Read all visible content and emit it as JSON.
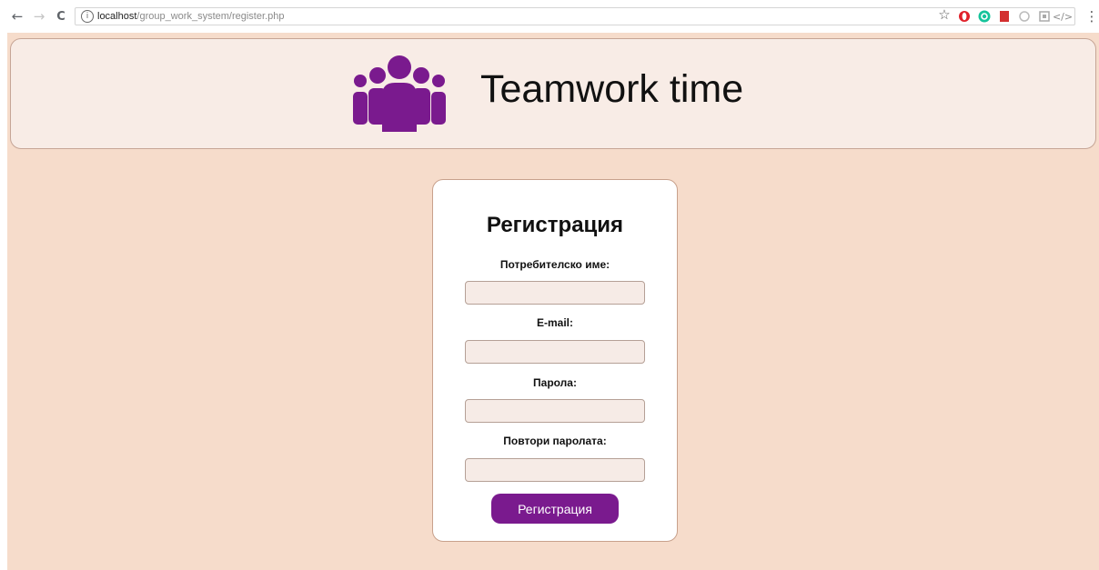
{
  "browser": {
    "back_glyph": "←",
    "forward_glyph": "→",
    "reload_glyph": "C",
    "url_host": "localhost",
    "url_path": "/group_work_system/register.php",
    "extensions": [
      "star-icon",
      "opera-icon",
      "grammarly-icon",
      "bookmark-red-icon",
      "extension-circle-icon",
      "extension-square-icon",
      "code-icon",
      "extension-box-icon",
      "menu-icon"
    ],
    "star_glyph": "☆",
    "menu_glyph": "⋮"
  },
  "header": {
    "title": "Teamwork time",
    "logo_icon": "team-people-icon",
    "logo_color": "#7a1a8e"
  },
  "form": {
    "title": "Регистрация",
    "username_label": "Потребителско име:",
    "email_label": "E-mail:",
    "password_label": "Парола:",
    "repeat_password_label": "Повтори паролата:",
    "submit_label": "Регистрация"
  },
  "colors": {
    "page_bg": "#f6dccb",
    "banner_bg": "#f8ece6",
    "accent": "#7a1a8e"
  }
}
